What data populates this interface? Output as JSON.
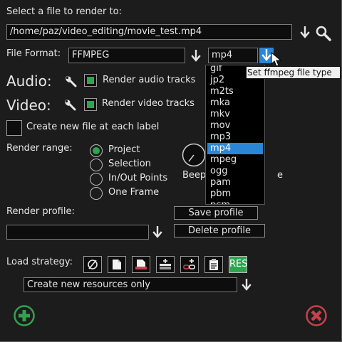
{
  "file": {
    "select_label": "Select a file to render to:",
    "path": "/home/paz/video_editing/movie_test.mp4"
  },
  "format": {
    "label": "File Format:",
    "value": "FFMPEG",
    "type_value": "mp4",
    "tooltip": "Set ffmpeg file type"
  },
  "audio": {
    "label": "Audio:",
    "render_label": "Render audio tracks",
    "checked": true
  },
  "video": {
    "label": "Video:",
    "render_label": "Render video tracks",
    "checked": true
  },
  "new_file": {
    "label": "Create new file at each label",
    "checked": false
  },
  "render_range": {
    "label": "Render range:",
    "options": [
      "Project",
      "Selection",
      "In/Out Points",
      "One Frame"
    ],
    "selected": "Project"
  },
  "beep": {
    "label_fragment": "Beep",
    "label_tail": "e"
  },
  "filetypes": [
    "gif",
    "jp2",
    "m2ts",
    "mka",
    "mkv",
    "mov",
    "mp3",
    "mp4",
    "mpeg",
    "ogg",
    "pam",
    "pbm",
    "pcm"
  ],
  "filetype_selected": "mp4",
  "profile": {
    "label": "Render profile:",
    "value": "",
    "save_label": "Save profile",
    "delete_label": "Delete profile"
  },
  "load_strategy": {
    "label": "Load strategy:",
    "res_label": "RES",
    "value": "Create new resources only"
  },
  "colors": {
    "accent_green": "#2fa44f",
    "accent_red": "#c8404a",
    "selection_blue": "#2b86d6"
  },
  "icons": {
    "browse": "down-arrow-icon",
    "search": "magnifier-icon",
    "wrench": "wrench-icon",
    "ok": "green-plus-circle-icon",
    "cancel": "red-x-circle-icon"
  }
}
